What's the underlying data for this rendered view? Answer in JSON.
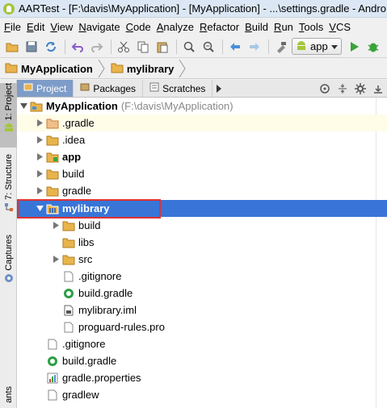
{
  "window": {
    "title": "AARTest - [F:\\davis\\MyApplication] - [MyApplication] - ...\\settings.gradle - Andro"
  },
  "menu": {
    "items": [
      {
        "label": "File"
      },
      {
        "label": "Edit"
      },
      {
        "label": "View"
      },
      {
        "label": "Navigate"
      },
      {
        "label": "Code"
      },
      {
        "label": "Analyze"
      },
      {
        "label": "Refactor"
      },
      {
        "label": "Build"
      },
      {
        "label": "Run"
      },
      {
        "label": "Tools"
      },
      {
        "label": "VCS"
      }
    ]
  },
  "toolbar": {
    "run_config_label": "app"
  },
  "breadcrumb": {
    "items": [
      {
        "label": "MyApplication"
      },
      {
        "label": "mylibrary"
      }
    ]
  },
  "left_stripe": {
    "project_tab": "1: Project",
    "structure_tab": "7: Structure",
    "captures_tab": "Captures",
    "variants_tab": "ants"
  },
  "panel": {
    "tabs": [
      {
        "label": "Project"
      },
      {
        "label": "Packages"
      },
      {
        "label": "Scratches"
      }
    ]
  },
  "tree": {
    "rows": [
      {
        "name": "MyApplication",
        "path": "(F:\\davis\\MyApplication)",
        "icon": "module-folder-icon",
        "state": "expanded"
      },
      {
        "name": ".gradle",
        "icon": "excluded-folder-icon",
        "state": "collapsed"
      },
      {
        "name": ".idea",
        "icon": "folder-icon",
        "state": "collapsed"
      },
      {
        "name": "app",
        "icon": "android-module-icon",
        "state": "collapsed"
      },
      {
        "name": "build",
        "icon": "folder-icon",
        "state": "collapsed"
      },
      {
        "name": "gradle",
        "icon": "folder-icon",
        "state": "collapsed"
      },
      {
        "name": "mylibrary",
        "icon": "library-module-icon",
        "state": "expanded"
      },
      {
        "name": "build",
        "icon": "folder-icon",
        "state": "collapsed"
      },
      {
        "name": "libs",
        "icon": "folder-icon",
        "state": "leaf"
      },
      {
        "name": "src",
        "icon": "folder-icon",
        "state": "collapsed"
      },
      {
        "name": ".gitignore",
        "icon": "file-icon",
        "state": "leaf"
      },
      {
        "name": "build.gradle",
        "icon": "gradle-file-icon",
        "state": "leaf"
      },
      {
        "name": "mylibrary.iml",
        "icon": "iml-file-icon",
        "state": "leaf"
      },
      {
        "name": "proguard-rules.pro",
        "icon": "file-icon",
        "state": "leaf"
      },
      {
        "name": ".gitignore",
        "icon": "file-icon",
        "state": "leaf"
      },
      {
        "name": "build.gradle",
        "icon": "gradle-file-icon",
        "state": "leaf"
      },
      {
        "name": "gradle.properties",
        "icon": "properties-file-icon",
        "state": "leaf"
      },
      {
        "name": "gradlew",
        "icon": "file-icon",
        "state": "leaf"
      }
    ]
  },
  "colors": {
    "selection": "#3875d7",
    "highlight_box": "#e0312f",
    "current_row": "#fffce8"
  }
}
